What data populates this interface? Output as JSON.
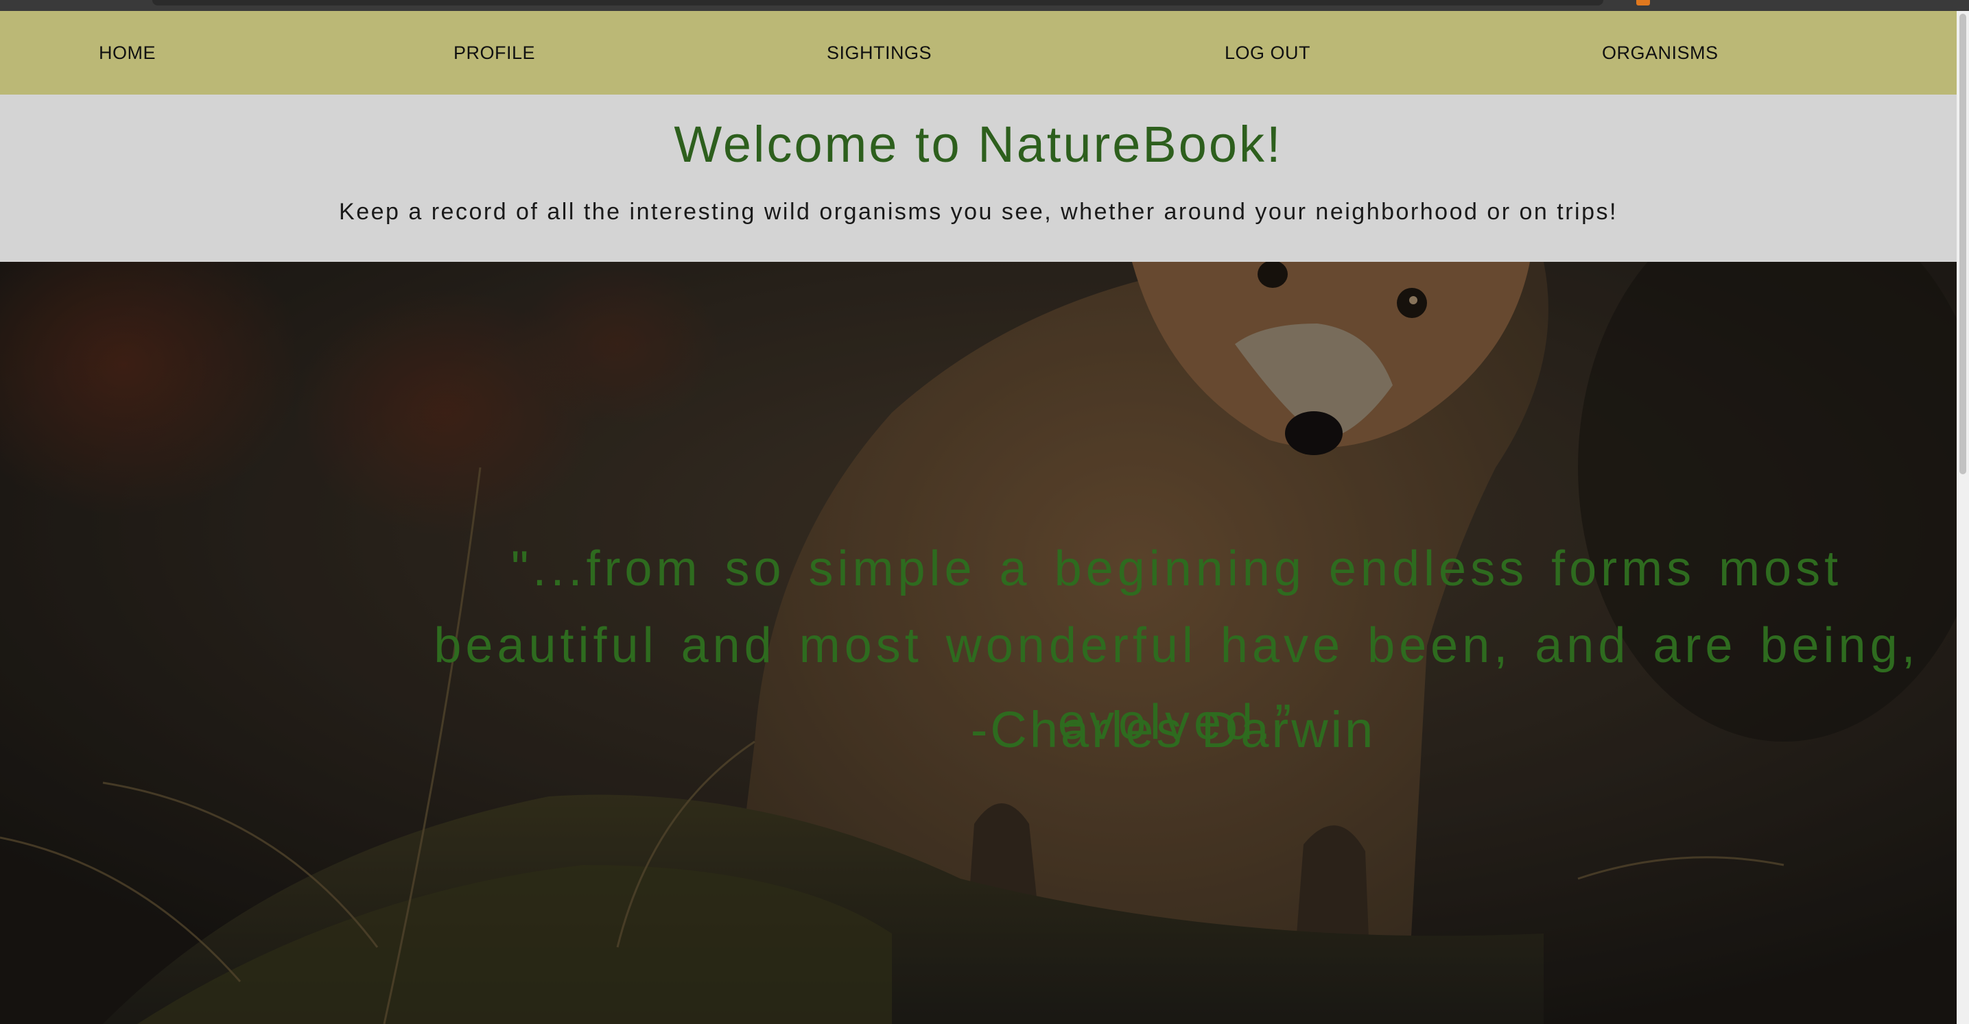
{
  "nav": {
    "items": [
      {
        "label": "HOME"
      },
      {
        "label": "PROFILE"
      },
      {
        "label": "SIGHTINGS"
      },
      {
        "label": "LOG OUT"
      },
      {
        "label": "ORGANISMS"
      }
    ]
  },
  "header": {
    "title": "Welcome to NatureBook!",
    "subtitle": "Keep a record of all the interesting wild organisms you see, whether around your neighborhood or on trips!"
  },
  "hero": {
    "quote": "\"...from so simple a beginning endless forms most beautiful and most wonderful have been, and are being, evolved.”",
    "author": "-Charles Darwin"
  },
  "colors": {
    "nav_background": "#bbb876",
    "header_background": "#d4d4d4",
    "title_green": "#2d5f1d",
    "quote_green": "#2e6b1f"
  }
}
